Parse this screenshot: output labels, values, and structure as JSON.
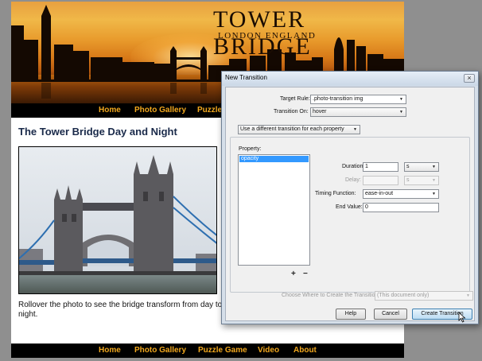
{
  "site": {
    "title": "Tower Bridge",
    "subtitle": "London England",
    "nav": [
      "Home",
      "Photo Gallery",
      "Puzzle Game",
      "Video",
      "About"
    ],
    "top_nav_partial": [
      "Home",
      "Photo Gallery",
      "Puzzle"
    ],
    "heading": "The Tower Bridge Day and Night",
    "caption": "Rollover the photo to see the bridge transform from day to night."
  },
  "dialog": {
    "title": "New Transition",
    "close_icon": "×",
    "target_rule_label": "Target Rule:",
    "target_rule_value": ".photo-transition img",
    "transition_on_label": "Transition On:",
    "transition_on_value": "hover",
    "mode_value": "Use a different transition for each property",
    "property_label": "Property:",
    "properties": [
      "opacity"
    ],
    "add_label": "+",
    "remove_label": "−",
    "duration_label": "Duration:",
    "duration_value": "1",
    "duration_unit": "s",
    "delay_label": "Delay:",
    "delay_value": "",
    "delay_unit": "s",
    "timing_label": "Timing Function:",
    "timing_value": "ease-in-out",
    "end_value_label": "End Value:",
    "end_value": "0",
    "create_where_label": "Choose Where to Create the Transition:",
    "create_where_value": "(This document only)",
    "help_label": "Help",
    "cancel_label": "Cancel",
    "create_label": "Create Transition"
  },
  "colors": {
    "nav_text": "#f2a81e",
    "selection": "#3399ff",
    "heading": "#1a2a4a"
  }
}
